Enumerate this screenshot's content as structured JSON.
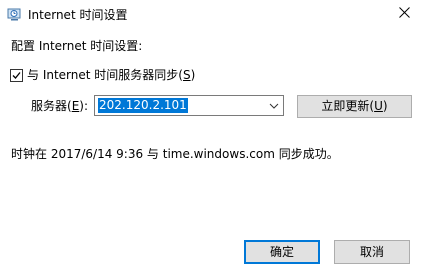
{
  "window": {
    "title": "Internet 时间设置",
    "icon": "clock-globe-icon",
    "close_glyph": "✕"
  },
  "main": {
    "section_label": "配置 Internet 时间设置:",
    "sync_checkbox": {
      "checked": true,
      "label_prefix": "与 Internet 时间服务器同步(",
      "label_mnemonic": "S",
      "label_suffix": ")"
    },
    "server": {
      "label_prefix": "服务器(",
      "label_mnemonic": "E",
      "label_suffix": "):",
      "value": "202.120.2.101"
    },
    "update_button": {
      "label_prefix": "立即更新(",
      "label_mnemonic": "U",
      "label_suffix": ")"
    },
    "status": "时钟在 2017/6/14 9:36 与 time.windows.com 同步成功。"
  },
  "footer": {
    "ok_label": "确定",
    "cancel_label": "取消"
  },
  "colors": {
    "accent": "#0078d7",
    "button_bg": "#e1e1e1",
    "button_border": "#adadad"
  }
}
